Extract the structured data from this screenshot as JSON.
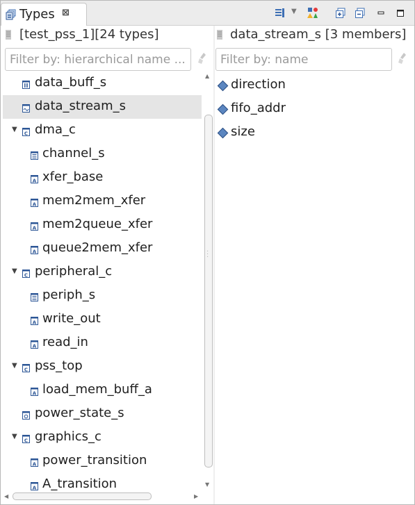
{
  "view": {
    "tab_title": "Types",
    "close_glyph": "⊠"
  },
  "types_pane": {
    "header": "[test_pss_1][24 types]",
    "filter_placeholder": "Filter by: hierarchical name ...",
    "tree": [
      {
        "label": "data_buff_s",
        "level": 1,
        "icon": "buffer-icon",
        "expanded": null,
        "selected": false
      },
      {
        "label": "data_stream_s",
        "level": 1,
        "icon": "stream-icon",
        "expanded": null,
        "selected": true
      },
      {
        "label": "dma_c",
        "level": 1,
        "icon": "component-icon",
        "expanded": true,
        "selected": false
      },
      {
        "label": "channel_s",
        "level": 2,
        "icon": "struct-icon",
        "expanded": null,
        "selected": false
      },
      {
        "label": "xfer_base",
        "level": 2,
        "icon": "action-icon",
        "expanded": null,
        "selected": false
      },
      {
        "label": "mem2mem_xfer",
        "level": 2,
        "icon": "action-icon",
        "expanded": null,
        "selected": false
      },
      {
        "label": "mem2queue_xfer",
        "level": 2,
        "icon": "action-icon",
        "expanded": null,
        "selected": false
      },
      {
        "label": "queue2mem_xfer",
        "level": 2,
        "icon": "action-icon",
        "expanded": null,
        "selected": false
      },
      {
        "label": "peripheral_c",
        "level": 1,
        "icon": "component-icon",
        "expanded": true,
        "selected": false
      },
      {
        "label": "periph_s",
        "level": 2,
        "icon": "struct-icon",
        "expanded": null,
        "selected": false
      },
      {
        "label": "write_out",
        "level": 2,
        "icon": "action-icon",
        "expanded": null,
        "selected": false
      },
      {
        "label": "read_in",
        "level": 2,
        "icon": "action-icon",
        "expanded": null,
        "selected": false
      },
      {
        "label": "pss_top",
        "level": 1,
        "icon": "component-icon",
        "expanded": true,
        "selected": false
      },
      {
        "label": "load_mem_buff_a",
        "level": 2,
        "icon": "action-icon",
        "expanded": null,
        "selected": false
      },
      {
        "label": "power_state_s",
        "level": 1,
        "icon": "state-icon",
        "expanded": null,
        "selected": false
      },
      {
        "label": "graphics_c",
        "level": 1,
        "icon": "component-icon",
        "expanded": true,
        "selected": false
      },
      {
        "label": "power_transition",
        "level": 2,
        "icon": "action-icon",
        "expanded": null,
        "selected": false
      },
      {
        "label": "A_transition",
        "level": 2,
        "icon": "action-icon",
        "expanded": null,
        "selected": false
      }
    ]
  },
  "members_pane": {
    "header": "data_stream_s [3 members]",
    "filter_placeholder": "Filter by: name",
    "members": [
      {
        "label": "direction",
        "icon": "field-diamond-icon"
      },
      {
        "label": "fifo_addr",
        "icon": "field-diamond-icon"
      },
      {
        "label": "size",
        "icon": "field-diamond-icon"
      }
    ]
  },
  "toolbar": {
    "icons": [
      "layout-icon",
      "dropdown-arrow-icon",
      "shapes-icon",
      "expand-all-icon",
      "collapse-all-icon",
      "minimize-icon",
      "maximize-icon"
    ]
  },
  "colors": {
    "selection_bg": "#e5e5e5",
    "icon_blue": "#3d6fb4",
    "member_diamond": "#5b86c0"
  }
}
